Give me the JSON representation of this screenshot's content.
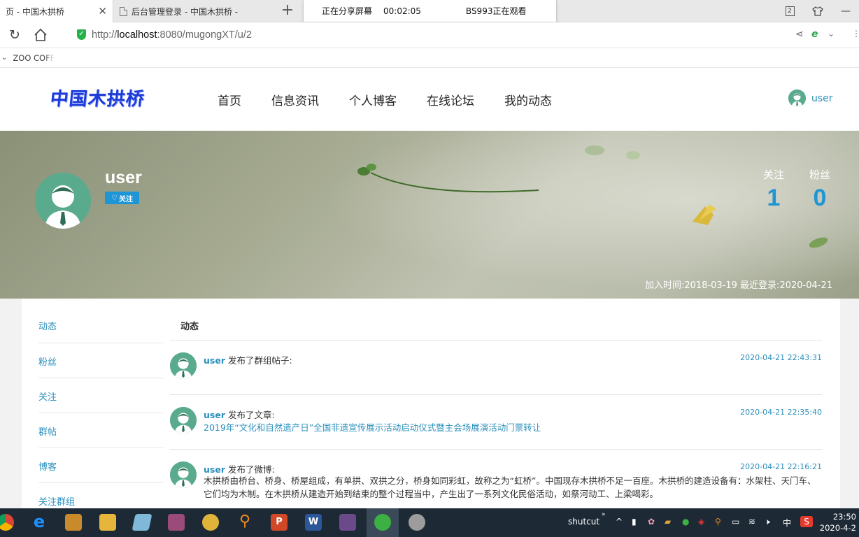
{
  "browser": {
    "tabs": [
      {
        "title": "页 - 中国木拱桥",
        "active": true
      },
      {
        "title": "后台管理登录 - 中国木拱桥 -",
        "active": false
      }
    ],
    "share_bar": {
      "status": "正在分享屏幕",
      "timer": "00:02:05",
      "viewer": "BS993正在观看"
    },
    "tab_count": "2",
    "url_prefix": "http://",
    "url_host": "localhost",
    "url_rest": ":8080/mugongXT/u/2",
    "favorites_item": "ZOO COFF"
  },
  "site": {
    "logo": "中国木拱桥",
    "nav": [
      "首页",
      "信息资讯",
      "个人博客",
      "在线论坛",
      "我的动态"
    ],
    "current_user": "user"
  },
  "profile": {
    "name": "user",
    "follow_label": "关注",
    "following_label": "关注",
    "following_count": "1",
    "fans_label": "粉丝",
    "fans_count": "0",
    "joined_info": "加入时间:2018-03-19 最近登录:2020-04-21"
  },
  "sidebar": {
    "items": [
      "动态",
      "粉丝",
      "关注",
      "群帖",
      "博客",
      "关注群组"
    ]
  },
  "feed": {
    "title": "动态",
    "items": [
      {
        "user": "user",
        "action": "发布了群组帖子:",
        "time": "2020-04-21 22:43:31"
      },
      {
        "user": "user",
        "action": "发布了文章:",
        "time": "2020-04-21 22:35:40",
        "link": "2019年“文化和自然遗产日”全国非遗宣传展示活动启动仪式暨主会场展演活动门票转让"
      },
      {
        "user": "user",
        "action": "发布了微博:",
        "time": "2020-04-21 22:16:21",
        "body": "木拱桥由桥台、桥身、桥屋组成，有单拱、双拱之分，桥身如同彩虹，故称之为“虹桥”。中国现存木拱桥不足一百座。木拱桥的建造设备有：水架柱、天门车、它们均为木制。在木拱桥从建造开始到结束的整个过程当中，产生出了一系列文化民俗活动，如祭河动工、上梁喝彩。"
      }
    ]
  },
  "taskbar": {
    "app_label": "shutcut",
    "ime": "中",
    "time": "23:50",
    "date": "2020-4-2"
  },
  "colors": {
    "accent": "#2a8fbd",
    "badge": "#1e95d4",
    "avatar": "#5aab8e",
    "logo": "#1d3bd6"
  }
}
